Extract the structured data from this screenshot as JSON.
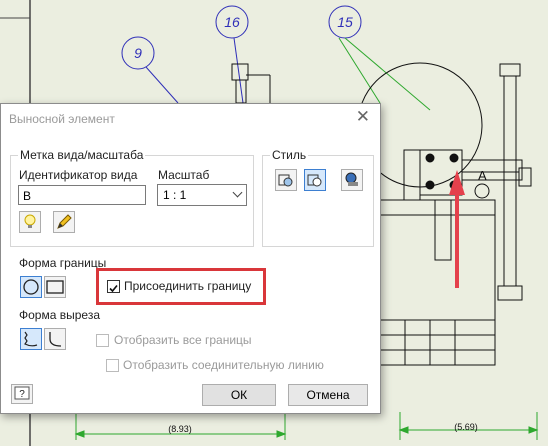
{
  "drawing": {
    "balloons": [
      "9",
      "16",
      "15"
    ],
    "dim_left": "(8.93)",
    "dim_right": "(5.69)",
    "detail_letter": "A"
  },
  "dialog": {
    "title": "Выносной элемент",
    "view_label_group": "Метка вида/масштаба",
    "view_id_label": "Идентификатор вида",
    "view_id_value": "В",
    "scale_label": "Масштаб",
    "scale_value": "1 : 1",
    "style_group": "Стиль",
    "boundary_shape_label": "Форма границы",
    "attach_boundary_label": "Присоединить границу",
    "attach_boundary_checked": true,
    "cutout_shape_label": "Форма выреза",
    "show_all_boundaries_label": "Отобразить все границы",
    "show_connection_line_label": "Отобразить соединительную линию",
    "ok_label": "ОК",
    "cancel_label": "Отмена"
  },
  "colors": {
    "balloon": "#2f2fb8",
    "leader_green": "#2ea82e",
    "highlight_red": "#d9363a",
    "arrow_red": "#e4414c"
  }
}
